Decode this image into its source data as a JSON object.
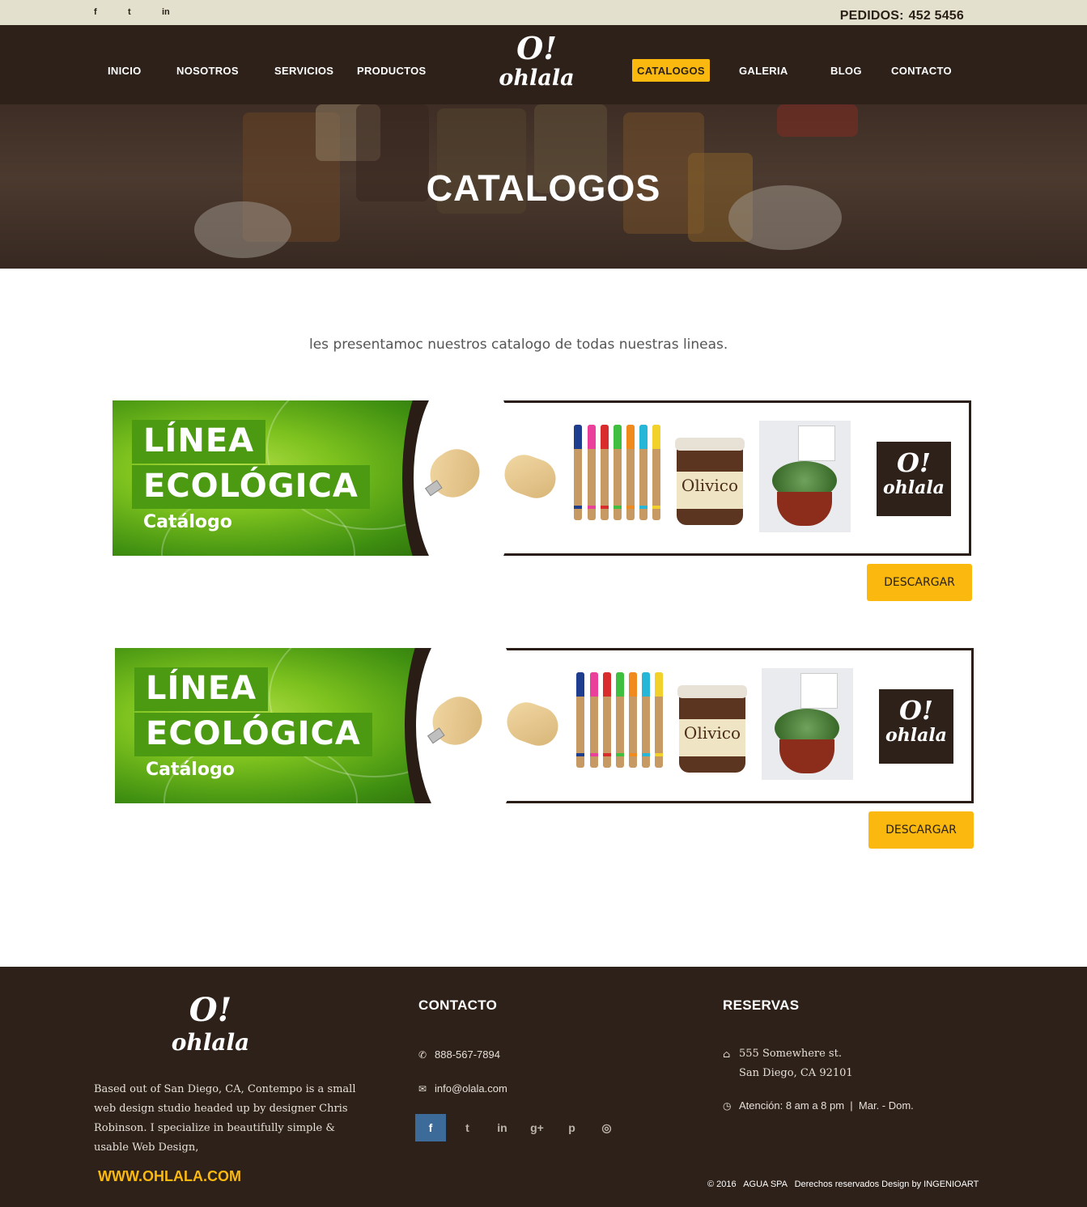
{
  "topbar": {
    "social_icons": [
      "facebook-icon",
      "twitter-icon",
      "linkedin-icon"
    ],
    "social_glyphs": [
      "f",
      "t",
      "in"
    ],
    "orders_label": "PEDIDOS:",
    "orders_number": "452 5456"
  },
  "brand": {
    "mark": "O!",
    "name": "ohlala"
  },
  "nav": {
    "items": [
      {
        "label": "INICIO"
      },
      {
        "label": "NOSOTROS"
      },
      {
        "label": "SERVICIOS"
      },
      {
        "label": "PRODUCTOS"
      },
      {
        "label": "CATALOGOS",
        "active": true
      },
      {
        "label": "GALERIA"
      },
      {
        "label": "BLOG"
      },
      {
        "label": "CONTACTO"
      }
    ]
  },
  "hero": {
    "title": "CATALOGOS"
  },
  "intro": "les presentamoc nuestros catalogo de todas nuestras lineas.",
  "catalogs": [
    {
      "line1": "LÍNEA",
      "line2": "ECOLÓGICA",
      "subtitle": "Catálogo",
      "jar_label": "Olivico",
      "button": "DESCARGAR"
    },
    {
      "line1": "LÍNEA",
      "line2": "ECOLÓGICA",
      "subtitle": "Catálogo",
      "jar_label": "Olivico",
      "button": "DESCARGAR"
    }
  ],
  "footer": {
    "about": "Based out of San Diego, CA, Contempo is a small web design studio headed up by designer Chris Robinson. I specialize in beautifully simple & usable Web Design,",
    "website": "WWW.OHLALA.COM",
    "contact": {
      "heading": "CONTACTO",
      "phone": "888-567-7894",
      "email": "info@olala.com",
      "social_icons": [
        "facebook-icon",
        "twitter-icon",
        "linkedin-icon",
        "google-plus-icon",
        "pinterest-icon",
        "instagram-icon"
      ],
      "social_glyphs": [
        "f",
        "t",
        "in",
        "g+",
        "p",
        "◎"
      ]
    },
    "reservations": {
      "heading": "RESERVAS",
      "address_line1": "555 Somewhere st.",
      "address_line2": "San Diego, CA 92101",
      "hours": "Atención: 8 am a 8 pm  |  Mar. - Dom."
    },
    "copyright": "© 2016   AGUA SPA   Derechos reservados Design by INGENIOART"
  },
  "colors": {
    "accent": "#fbb90f",
    "dark_brown": "#2e2119",
    "topbar_bg": "#e3e1cd",
    "green": "#4c9a12"
  }
}
